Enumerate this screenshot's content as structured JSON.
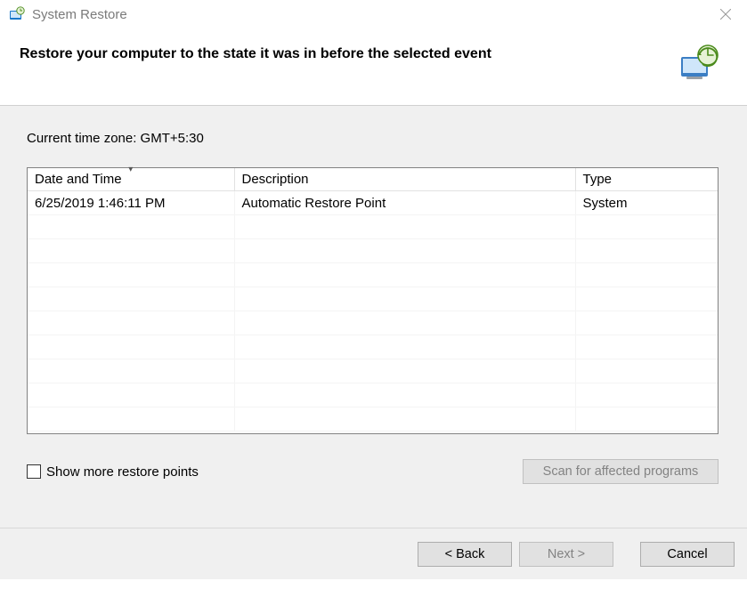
{
  "window": {
    "title": "System Restore"
  },
  "header": {
    "headline": "Restore your computer to the state it was in before the selected event"
  },
  "content": {
    "timezone_label": "Current time zone: GMT+5:30",
    "columns": {
      "date": "Date and Time",
      "desc": "Description",
      "type": "Type"
    },
    "rows": [
      {
        "date": "6/25/2019 1:46:11 PM",
        "desc": "Automatic Restore Point",
        "type": "System"
      }
    ],
    "show_more_label": "Show more restore points",
    "scan_button": "Scan for affected programs"
  },
  "footer": {
    "back": "< Back",
    "next": "Next >",
    "cancel": "Cancel"
  }
}
